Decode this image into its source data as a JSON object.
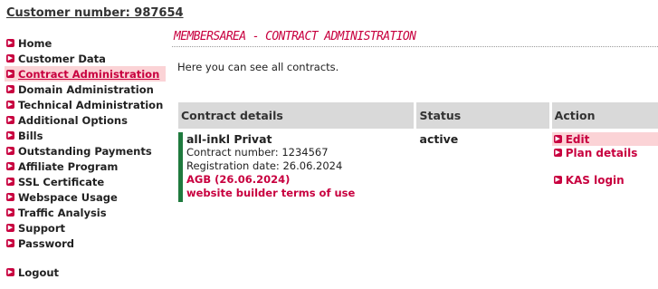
{
  "header": {
    "customer_number": "Customer number: 987654"
  },
  "sidebar": {
    "items": [
      {
        "label": "Home"
      },
      {
        "label": "Customer Data"
      },
      {
        "label": "Contract Administration"
      },
      {
        "label": "Domain Administration"
      },
      {
        "label": "Technical Administration"
      },
      {
        "label": "Additional Options"
      },
      {
        "label": "Bills"
      },
      {
        "label": "Outstanding Payments"
      },
      {
        "label": "Affiliate Program"
      },
      {
        "label": "SSL Certificate"
      },
      {
        "label": "Webspace Usage"
      },
      {
        "label": "Traffic Analysis"
      },
      {
        "label": "Support"
      },
      {
        "label": "Password"
      }
    ],
    "active_item": "Contract Administration",
    "logout_label": "Logout"
  },
  "main": {
    "title": "MEMBERSAREA - CONTRACT ADMINISTRATION",
    "intro": "Here you can see all contracts.",
    "table": {
      "headers": {
        "details": "Contract details",
        "status": "Status",
        "action": "Action"
      },
      "rows": [
        {
          "name": "all-inkl Privat",
          "contract_number": "Contract number: 1234567",
          "registration_date": "Registration date: 26.06.2024",
          "agb_link": "AGB (26.06.2024)",
          "terms_link": "website builder terms of use",
          "status": "active",
          "actions": {
            "edit": "Edit",
            "plan_details": "Plan details",
            "kas_login": "KAS login"
          }
        }
      ]
    }
  },
  "colors": {
    "accent": "#c8003f",
    "highlight": "#fbd3d6",
    "header_bg": "#d9d9d9",
    "row_bar": "#1f7a3e"
  },
  "icons": {
    "nav_bullet": "arrow-bullet-icon"
  }
}
